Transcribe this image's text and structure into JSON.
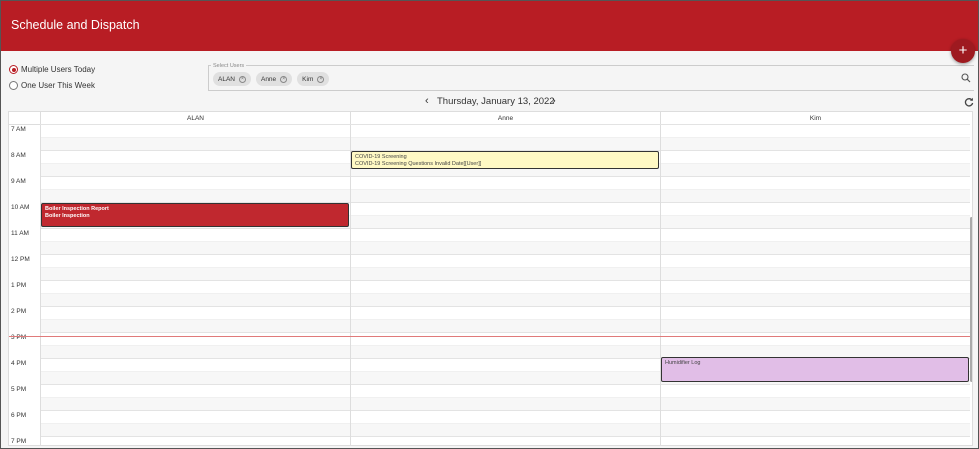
{
  "header": {
    "title": "Schedule and Dispatch"
  },
  "fab": {
    "label": "+",
    "icon": "plus-icon"
  },
  "view_mode": {
    "options": [
      {
        "label": "Multiple Users Today",
        "selected": true
      },
      {
        "label": "One User This Week",
        "selected": false
      }
    ]
  },
  "users": {
    "legend": "Select Users",
    "selected": [
      "ALAN",
      "Anne",
      "Kim"
    ],
    "search_icon": "search-icon"
  },
  "date_nav": {
    "date": "Thursday, January 13, 2022",
    "prev": "‹",
    "next": "›",
    "refresh_icon": "refresh-icon"
  },
  "columns": [
    "ALAN",
    "Anne",
    "Kim"
  ],
  "hours": [
    "7 AM",
    "8 AM",
    "9 AM",
    "10 AM",
    "11 AM",
    "12 PM",
    "1 PM",
    "2 PM",
    "3 PM",
    "4 PM",
    "5 PM",
    "6 PM",
    "7 PM"
  ],
  "events": [
    {
      "column": "ALAN",
      "start": "10 AM",
      "end": "11 AM",
      "line1": "Boiler Inspection Report",
      "line2": "Boiler Inspection",
      "color": "#c0282f"
    },
    {
      "column": "Anne",
      "start": "8 AM",
      "end": "8:45 AM",
      "line1": "COVID-19 Screening",
      "line2": "COVID-19 Screening Questions  Invalid Date[[User]]",
      "color": "#fff9c4"
    },
    {
      "column": "Kim",
      "start": "4 PM",
      "end": "5 PM",
      "line1": "Humidifier Log",
      "line2": "",
      "color": "#e1bee7"
    }
  ],
  "colors": {
    "brand": "#b81d24",
    "now_line": "#e07a7a"
  }
}
